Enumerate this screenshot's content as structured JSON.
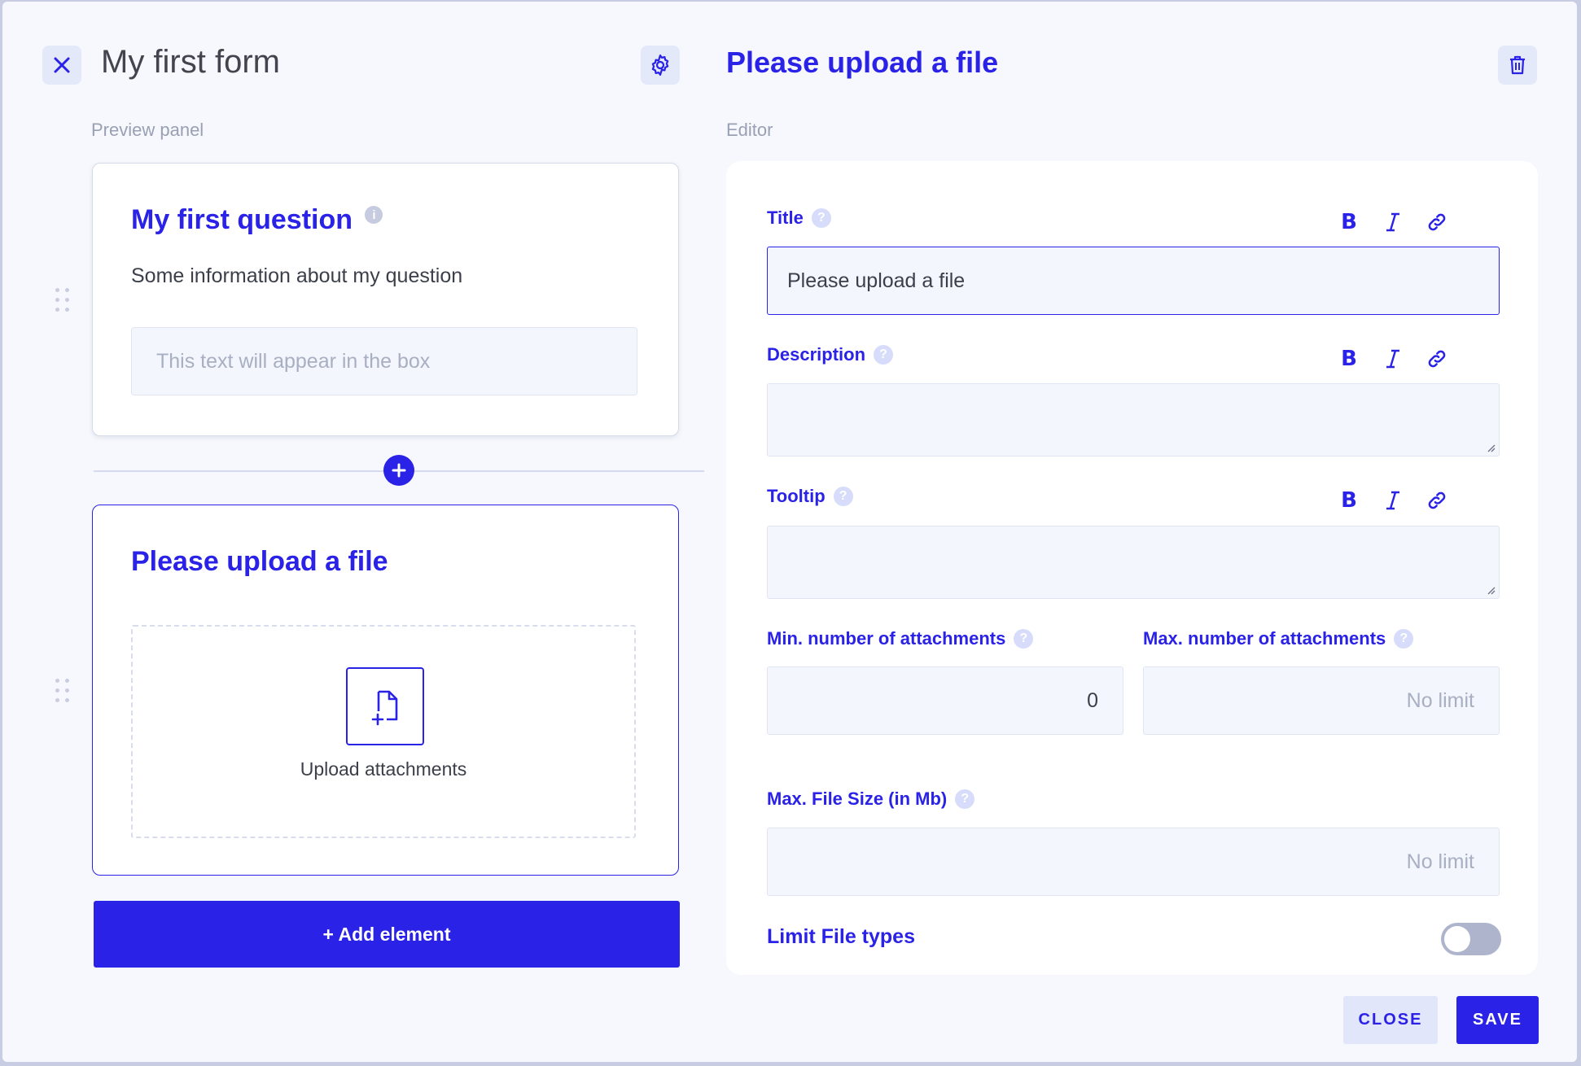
{
  "header": {
    "form_title": "My first form",
    "editor_title": "Please upload a file"
  },
  "preview": {
    "section_label": "Preview panel",
    "question1": {
      "title": "My first question",
      "description": "Some information about my question",
      "placeholder": "This text will appear in the box"
    },
    "question2": {
      "title": "Please upload a file",
      "upload_label": "Upload attachments"
    },
    "add_element_label": "+ Add element"
  },
  "editor": {
    "section_label": "Editor",
    "title_label": "Title",
    "title_value": "Please upload a file",
    "description_label": "Description",
    "tooltip_label": "Tooltip",
    "min_label": "Min. number of attachments",
    "min_value": "0",
    "max_label": "Max. number of attachments",
    "max_placeholder": "No limit",
    "filesize_label": "Max. File Size (in Mb)",
    "filesize_placeholder": "No limit",
    "limit_types_label": "Limit File types",
    "limit_types_enabled": false,
    "format_bold": "B"
  },
  "footer": {
    "close_label": "CLOSE",
    "save_label": "SAVE"
  },
  "colors": {
    "accent": "#2a22e6",
    "background": "#f6f8fd",
    "input_bg": "#f3f6fd"
  }
}
